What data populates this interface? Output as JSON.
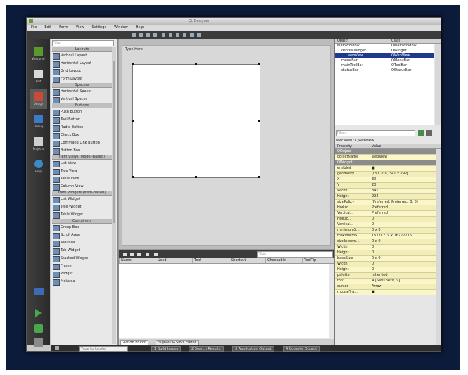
{
  "window": {
    "title": "Qt Designer"
  },
  "menu": [
    "File",
    "Edit",
    "Form",
    "View",
    "Settings",
    "Window",
    "Help"
  ],
  "modes": [
    {
      "label": "Welcome",
      "icon": "welcome-icon"
    },
    {
      "label": "Edit",
      "icon": "edit-icon"
    },
    {
      "label": "Design",
      "icon": "design-icon"
    },
    {
      "label": "Debug",
      "icon": "debug-icon"
    },
    {
      "label": "Projects",
      "icon": "projects-icon"
    },
    {
      "label": "Help",
      "icon": "help-icon"
    }
  ],
  "widget_box": {
    "filter_placeholder": "Filter",
    "groups": [
      {
        "category": "Layouts",
        "items": [
          "Vertical Layout",
          "Horizontal Layout",
          "Grid Layout",
          "Form Layout"
        ]
      },
      {
        "category": "Spacers",
        "items": [
          "Horizontal Spacer",
          "Vertical Spacer"
        ]
      },
      {
        "category": "Buttons",
        "items": [
          "Push Button",
          "Tool Button",
          "Radio Button",
          "Check Box",
          "Command Link Button",
          "Button Box"
        ]
      },
      {
        "category": "Item Views (Model-Based)",
        "items": [
          "List View",
          "Tree View",
          "Table View",
          "Column View"
        ]
      },
      {
        "category": "Item Widgets (Item-Based)",
        "items": [
          "List Widget",
          "Tree Widget",
          "Table Widget"
        ]
      },
      {
        "category": "Containers",
        "items": [
          "Group Box",
          "Scroll Area",
          "Tool Box",
          "Tab Widget",
          "Stacked Widget",
          "Frame",
          "Widget",
          "MdiArea"
        ]
      }
    ]
  },
  "form": {
    "label": "Type Here"
  },
  "object_inspector": {
    "headers": [
      "Object",
      "Class"
    ],
    "rows": [
      {
        "object": "MainWindow",
        "class": "QMainWindow"
      },
      {
        "object": "centralWidget",
        "class": "QWidget"
      },
      {
        "object": "webView",
        "class": "QWebView"
      },
      {
        "object": "menuBar",
        "class": "QMenuBar"
      },
      {
        "object": "mainToolBar",
        "class": "QToolBar"
      },
      {
        "object": "statusBar",
        "class": "QStatusBar"
      }
    ],
    "selected_index": 2
  },
  "property_editor": {
    "filter_placeholder": "Filter",
    "title": "webView : QWebView",
    "headers": [
      "Property",
      "Value"
    ],
    "rows": [
      {
        "name": "QObject",
        "value": "",
        "type": "cls"
      },
      {
        "name": "objectName",
        "value": "webView",
        "type": "y"
      },
      {
        "name": "QWidget",
        "value": "",
        "type": "cls"
      },
      {
        "name": "enabled",
        "value": "■",
        "type": "y"
      },
      {
        "name": "geometry",
        "value": "[(30, 20), 341 x 292]",
        "type": "y2"
      },
      {
        "name": "X",
        "value": "30",
        "type": "y"
      },
      {
        "name": "Y",
        "value": "20",
        "type": "y2"
      },
      {
        "name": "Width",
        "value": "341",
        "type": "y"
      },
      {
        "name": "Height",
        "value": "292",
        "type": "y2"
      },
      {
        "name": "sizePolicy",
        "value": "[Preferred, Preferred, 0, 0]",
        "type": "y"
      },
      {
        "name": "Horizo...",
        "value": "Preferred",
        "type": "y2"
      },
      {
        "name": "Vertical...",
        "value": "Preferred",
        "type": "y"
      },
      {
        "name": "Horizo...",
        "value": "0",
        "type": "y2"
      },
      {
        "name": "Vertical...",
        "value": "0",
        "type": "y"
      },
      {
        "name": "minimumS...",
        "value": "0 x 0",
        "type": "y2"
      },
      {
        "name": "maximumS...",
        "value": "16777215 x 16777215",
        "type": "y"
      },
      {
        "name": "sizeIncrem...",
        "value": "0 x 0",
        "type": "y2"
      },
      {
        "name": "Width",
        "value": "0",
        "type": "y"
      },
      {
        "name": "Height",
        "value": "0",
        "type": "y2"
      },
      {
        "name": "baseSize",
        "value": "0 x 0",
        "type": "y"
      },
      {
        "name": "Width",
        "value": "0",
        "type": "y2"
      },
      {
        "name": "Height",
        "value": "0",
        "type": "y"
      },
      {
        "name": "palette",
        "value": "Inherited",
        "type": "y2"
      },
      {
        "name": "font",
        "value": "A [Sans Serif, 9]",
        "type": "y"
      },
      {
        "name": "cursor",
        "value": "Arrow",
        "type": "y2"
      },
      {
        "name": "mouseTra...",
        "value": "■",
        "type": "y"
      }
    ]
  },
  "action_editor": {
    "filter_placeholder": "Filter",
    "headers": [
      "Name",
      "Used",
      "Text",
      "Shortcut",
      "Checkable",
      "ToolTip"
    ],
    "tabs": [
      "Action Editor",
      "Signals & Slots Editor"
    ]
  },
  "statusbar": {
    "locator_placeholder": "Type to locate",
    "buttons": [
      "1 Build Issues",
      "2 Search Results",
      "3 Application Output",
      "4 Compile Output"
    ]
  }
}
